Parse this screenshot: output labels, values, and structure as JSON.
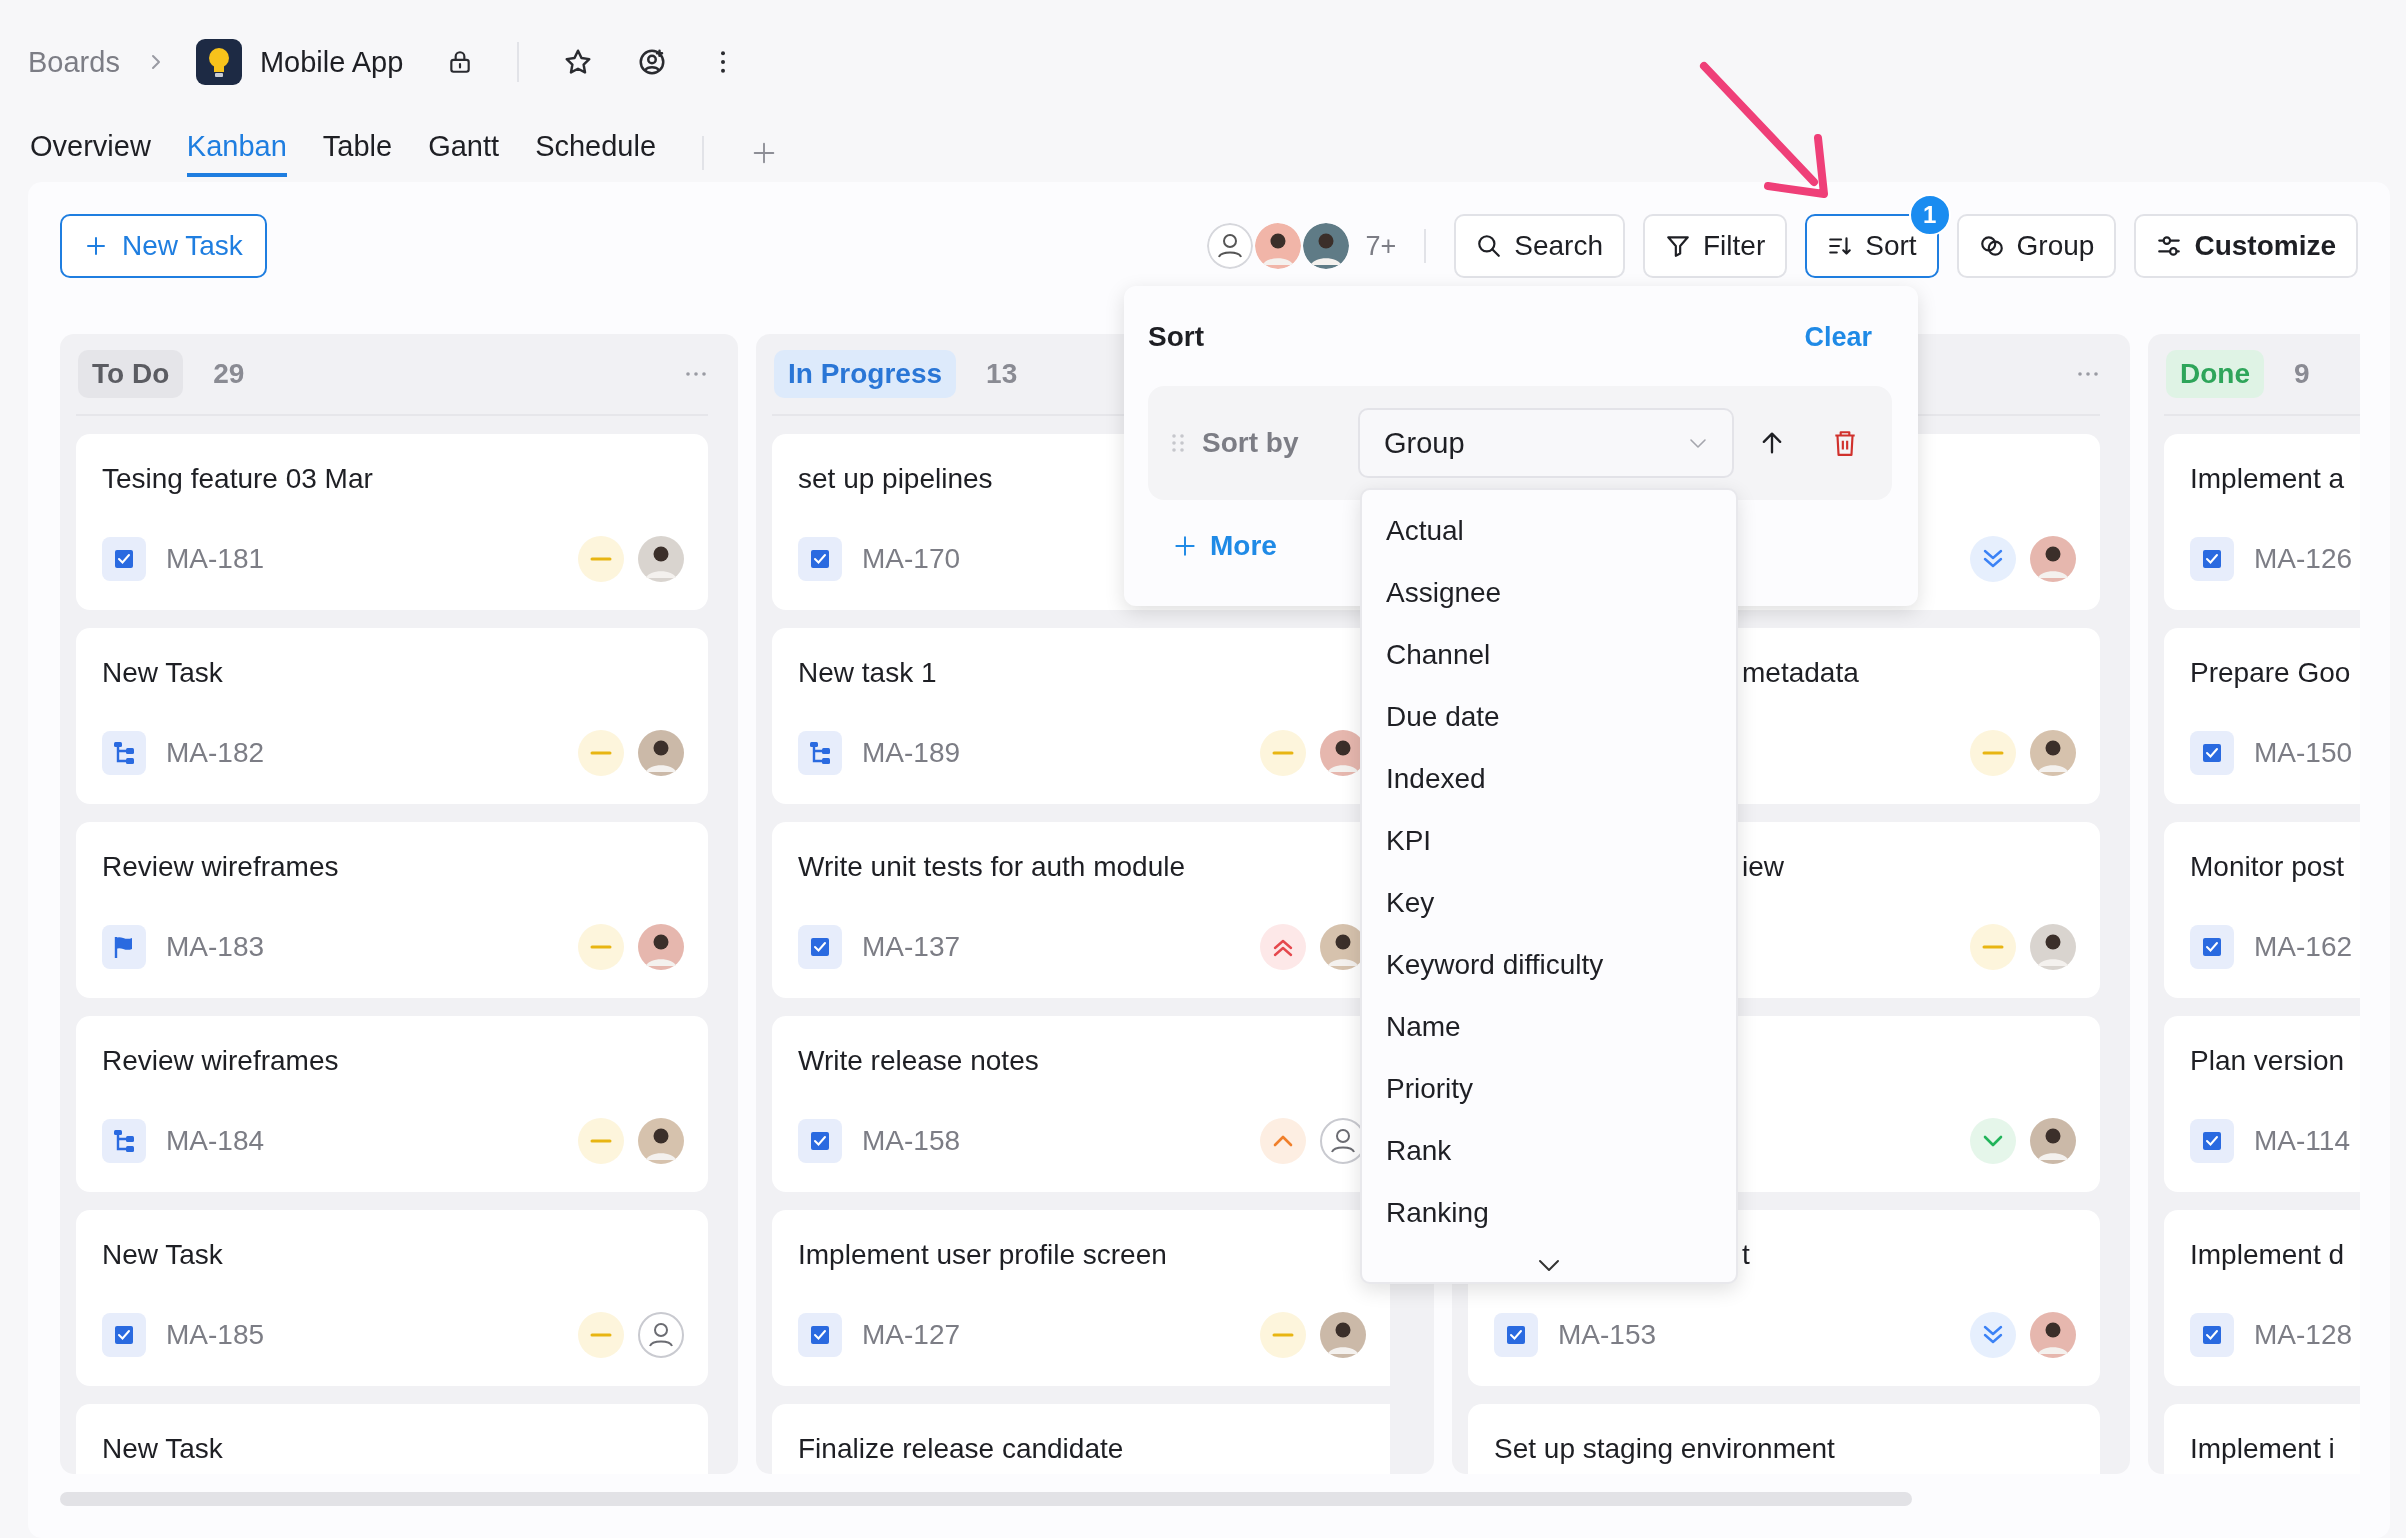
{
  "breadcrumb": {
    "root": "Boards",
    "board": "Mobile App"
  },
  "tabs": [
    {
      "label": "Overview",
      "selected": false
    },
    {
      "label": "Kanban",
      "selected": true
    },
    {
      "label": "Table",
      "selected": false
    },
    {
      "label": "Gantt",
      "selected": false
    },
    {
      "label": "Schedule",
      "selected": false
    }
  ],
  "toolbar": {
    "new_task": "New Task",
    "more_members": "7+",
    "buttons": [
      {
        "label": "Search",
        "selected": false
      },
      {
        "label": "Filter",
        "selected": false
      },
      {
        "label": "Sort",
        "selected": true,
        "badge": "1"
      },
      {
        "label": "Group",
        "selected": false
      },
      {
        "label": "Customize",
        "selected": false
      }
    ]
  },
  "columns": [
    {
      "title": "To Do",
      "kind": "todo",
      "count": "29",
      "cards": [
        {
          "title": "Tesing feature 03 Mar",
          "type": {
            "kind": "task"
          },
          "key": "MA-181",
          "priority": {
            "kind": "medium"
          },
          "assignee": {
            "kind": "photo"
          }
        },
        {
          "title": "New Task",
          "type": {
            "kind": "subtask"
          },
          "key": "MA-182",
          "priority": {
            "kind": "medium"
          },
          "assignee": {
            "kind": "photo"
          }
        },
        {
          "title": "Review wireframes",
          "type": {
            "kind": "story"
          },
          "key": "MA-183",
          "priority": {
            "kind": "medium"
          },
          "assignee": {
            "kind": "photo"
          }
        },
        {
          "title": "Review wireframes",
          "type": {
            "kind": "subtask"
          },
          "key": "MA-184",
          "priority": {
            "kind": "medium"
          },
          "assignee": {
            "kind": "photo"
          }
        },
        {
          "title": "New Task",
          "type": {
            "kind": "task"
          },
          "key": "MA-185",
          "priority": {
            "kind": "medium"
          },
          "assignee": {
            "kind": "empty"
          }
        },
        {
          "title": "New Task"
        }
      ]
    },
    {
      "title": "In Progress",
      "kind": "progress",
      "count": "13",
      "cards": [
        {
          "title": "set up pipelines",
          "type": {
            "kind": "task"
          },
          "key": "MA-170"
        },
        {
          "title": "New task 1",
          "type": {
            "kind": "subtask"
          },
          "key": "MA-189",
          "priority": {
            "kind": "medium"
          },
          "assignee": {
            "kind": "photo"
          }
        },
        {
          "title": "Write unit tests for auth module",
          "type": {
            "kind": "task"
          },
          "key": "MA-137",
          "priority": {
            "kind": "highest"
          },
          "assignee": {
            "kind": "photo"
          }
        },
        {
          "title": "Write release notes",
          "type": {
            "kind": "task"
          },
          "key": "MA-158",
          "priority": {
            "kind": "high"
          },
          "assignee": {
            "kind": "empty"
          }
        },
        {
          "title": "Implement user profile screen",
          "type": {
            "kind": "task"
          },
          "key": "MA-127",
          "priority": {
            "kind": "medium"
          },
          "assignee": {
            "kind": "photo"
          }
        },
        {
          "title": "Finalize release candidate"
        }
      ]
    },
    {
      "cards": [
        {
          "priority": {
            "kind": "lowest"
          },
          "assignee": {
            "kind": "photo"
          }
        },
        {
          "title": "metadata",
          "title_tail": true,
          "priority": {
            "kind": "medium"
          },
          "assignee": {
            "kind": "photo"
          }
        },
        {
          "title": "iew",
          "title_tail": true,
          "priority": {
            "kind": "medium"
          },
          "assignee": {
            "kind": "photo"
          }
        },
        {
          "priority": {
            "kind": "low"
          },
          "assignee": {
            "kind": "photo"
          }
        },
        {
          "title": "t",
          "title_tail": true,
          "type": {
            "kind": "task"
          },
          "key": "MA-153",
          "priority": {
            "kind": "lowest"
          },
          "assignee": {
            "kind": "photo"
          }
        },
        {
          "title": "Set up staging environment"
        }
      ]
    },
    {
      "title": "Done",
      "kind": "done",
      "count": "9",
      "cards": [
        {
          "title": "Implement a",
          "type": {
            "kind": "task"
          },
          "key": "MA-126"
        },
        {
          "title": "Prepare Goo",
          "type": {
            "kind": "task"
          },
          "key": "MA-150"
        },
        {
          "title": "Monitor post",
          "type": {
            "kind": "task"
          },
          "key": "MA-162"
        },
        {
          "title": "Plan version",
          "type": {
            "kind": "task"
          },
          "key": "MA-114"
        },
        {
          "title": "Implement d",
          "type": {
            "kind": "task"
          },
          "key": "MA-128"
        },
        {
          "title": "Implement i"
        }
      ]
    }
  ],
  "sort_panel": {
    "title": "Sort",
    "clear": "Clear",
    "label": "Sort by",
    "field": "Group",
    "ascending": true,
    "more": "More",
    "options": [
      "Actual",
      "Assignee",
      "Channel",
      "Due date",
      "Indexed",
      "KPI",
      "Key",
      "Keyword difficulty",
      "Name",
      "Priority",
      "Rank",
      "Ranking"
    ]
  }
}
